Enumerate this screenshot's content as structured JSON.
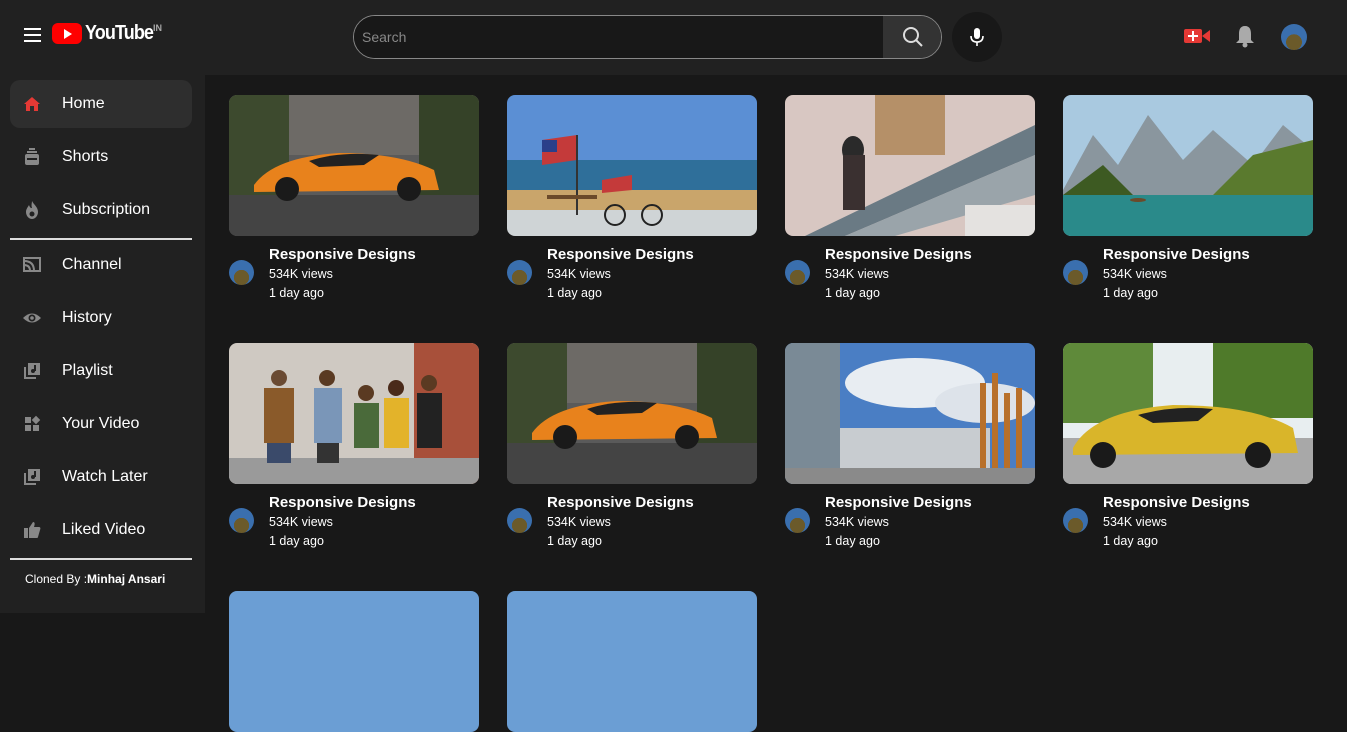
{
  "header": {
    "logo_text": "YouTube",
    "country_code": "IN",
    "search_placeholder": "Search",
    "brand_color": "#ff0000"
  },
  "sidebar": {
    "items": [
      {
        "label": "Home",
        "icon": "home-icon",
        "active": true
      },
      {
        "label": "Shorts",
        "icon": "shorts-icon"
      },
      {
        "label": "Subscription",
        "icon": "fire-icon"
      },
      {
        "label": "Channel",
        "icon": "cast-icon"
      },
      {
        "label": "History",
        "icon": "eye-icon"
      },
      {
        "label": "Playlist",
        "icon": "playlist-icon"
      },
      {
        "label": "Your Video",
        "icon": "grid-icon"
      },
      {
        "label": "Watch Later",
        "icon": "watch-later-icon"
      },
      {
        "label": "Liked Video",
        "icon": "thumbs-up-icon"
      }
    ],
    "credit_prefix": "Cloned By :",
    "credit_name": "Minhaj Ansari"
  },
  "videos": [
    {
      "title": "Responsive Designs",
      "views": "534K views",
      "age": "1 day ago",
      "thumb": "orange-sports-car"
    },
    {
      "title": "Responsive Designs",
      "views": "534K views",
      "age": "1 day ago",
      "thumb": "beach-flag"
    },
    {
      "title": "Responsive Designs",
      "views": "534K views",
      "age": "1 day ago",
      "thumb": "escalator-woman"
    },
    {
      "title": "Responsive Designs",
      "views": "534K views",
      "age": "1 day ago",
      "thumb": "mountain-lake"
    },
    {
      "title": "Responsive Designs",
      "views": "534K views",
      "age": "1 day ago",
      "thumb": "friends-walking"
    },
    {
      "title": "Responsive Designs",
      "views": "534K views",
      "age": "1 day ago",
      "thumb": "orange-sports-car"
    },
    {
      "title": "Responsive Designs",
      "views": "534K views",
      "age": "1 day ago",
      "thumb": "dcu-building"
    },
    {
      "title": "Responsive Designs",
      "views": "534K views",
      "age": "1 day ago",
      "thumb": "yellow-sports-car"
    },
    {
      "title": "",
      "views": "",
      "age": "",
      "thumb": "sky"
    },
    {
      "title": "",
      "views": "",
      "age": "",
      "thumb": "sky"
    }
  ]
}
